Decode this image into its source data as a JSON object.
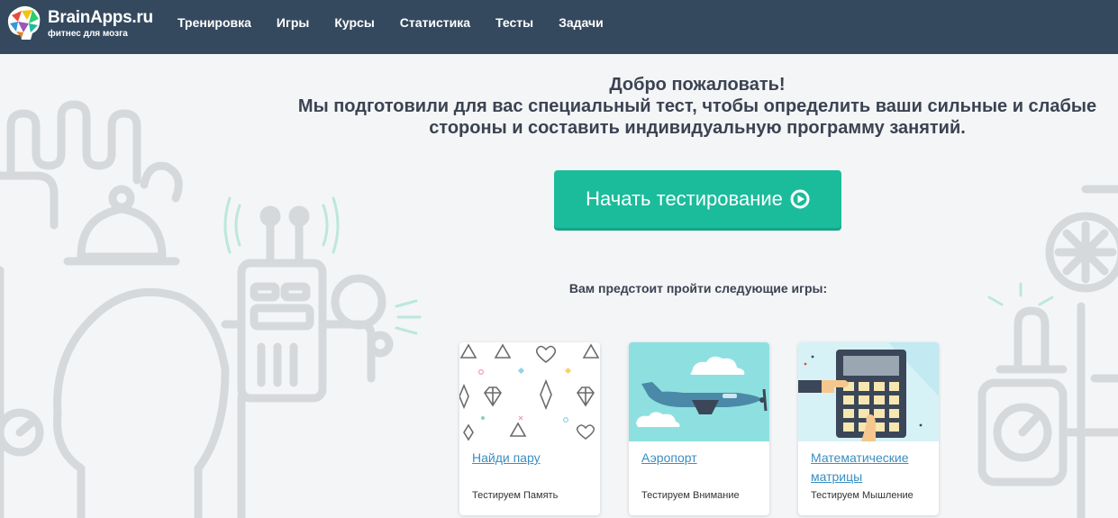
{
  "header": {
    "brand_name": "BrainApps.ru",
    "brand_tagline": "фитнес для мозга",
    "nav": [
      {
        "label": "Тренировка"
      },
      {
        "label": "Игры"
      },
      {
        "label": "Курсы"
      },
      {
        "label": "Статистика"
      },
      {
        "label": "Тесты"
      },
      {
        "label": "Задачи"
      }
    ]
  },
  "hero": {
    "line1": "Добро пожаловать!",
    "line2": "Мы подготовили для вас специальный тест, чтобы определить ваши сильные и слабые",
    "line3": "стороны и составить индивидуальную программу занятий.",
    "start_button": "Начать тестирование",
    "start_icon": "play-circle-icon"
  },
  "games": {
    "heading": "Вам предстоит пройти следующие игры:",
    "cards": [
      {
        "title": "Найди пару",
        "subtitle": "Тестируем Память",
        "image": "shapes-pattern"
      },
      {
        "title": "Аэропорт",
        "subtitle": "Тестируем Внимание",
        "image": "airplane"
      },
      {
        "title": "Математические матрицы",
        "subtitle": "Тестируем Мышление",
        "image": "calculator"
      }
    ]
  },
  "colors": {
    "header_bg": "#34495e",
    "accent": "#1bbc9b",
    "link": "#3a8ec3",
    "text": "#3b4351",
    "page_bg": "#f4f5f7"
  }
}
